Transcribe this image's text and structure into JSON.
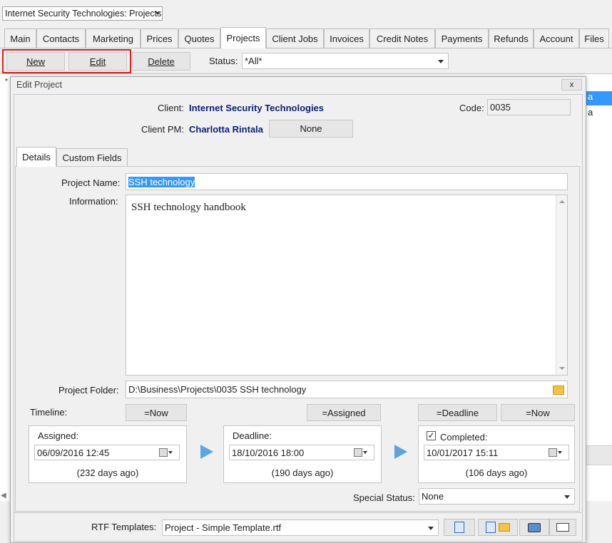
{
  "window_selector": "Internet Security Technologies: Projects",
  "tabs": [
    "Main",
    "Contacts",
    "Marketing",
    "Prices",
    "Quotes",
    "Projects",
    "Client Jobs",
    "Invoices",
    "Credit Notes",
    "Payments",
    "Refunds",
    "Account",
    "Files"
  ],
  "active_tab": "Projects",
  "toolbar": {
    "new": "New",
    "edit": "Edit",
    "delete": "Delete",
    "status_label": "Status:",
    "status_value": "*All*"
  },
  "background_rows": [
    "a",
    "a"
  ],
  "background_row_marker": "*",
  "dialog": {
    "title": "Edit Project",
    "close": "x",
    "client_label": "Client:",
    "client_value": "Internet Security Technologies",
    "code_label": "Code:",
    "code_value": "0035",
    "client_pm_label": "Client PM:",
    "client_pm_value": "Charlotta Rintala",
    "pm_none_button": "None",
    "inner_tabs": [
      "Details",
      "Custom Fields"
    ],
    "project_name_label": "Project Name:",
    "project_name_value": "SSH technology",
    "information_label": "Information:",
    "information_value": "SSH technology handbook",
    "project_folder_label": "Project Folder:",
    "project_folder_value": "D:\\Business\\Projects\\0035 SSH technology",
    "timeline_label": "Timeline:",
    "btn_now_1": "=Now",
    "btn_assigned": "=Assigned",
    "btn_deadline": "=Deadline",
    "btn_now_2": "=Now",
    "assigned": {
      "label": "Assigned:",
      "value": "06/09/2016 12:45",
      "ago": "(232 days ago)"
    },
    "deadline": {
      "label": "Deadline:",
      "value": "18/10/2016 18:00",
      "ago": "(190 days ago)"
    },
    "completed": {
      "label": "Completed:",
      "checked": true,
      "value": "10/01/2017 15:11",
      "ago": "(106 days ago)"
    },
    "special_status_label": "Special Status:",
    "special_status_value": "None",
    "rtf_label": "RTF Templates:",
    "rtf_value": "Project - Simple Template.rtf"
  },
  "colors": {
    "highlight_red": "#e0201b",
    "client_blue": "#0b1f7a",
    "selection_blue": "#3399ff",
    "arrow_blue": "#5aa6e0"
  }
}
